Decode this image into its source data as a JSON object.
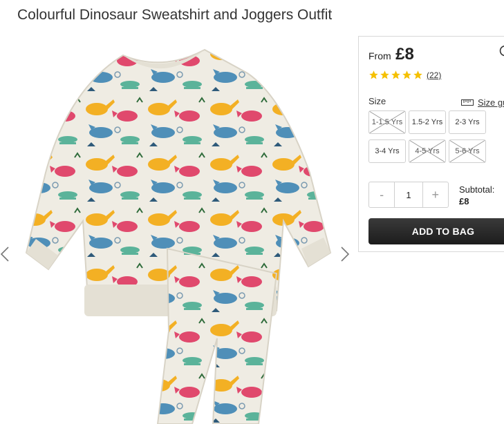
{
  "product": {
    "title": "Colourful Dinosaur Sweatshirt and Joggers Outfit",
    "price_from_label": "From",
    "price": "£8",
    "rating": 5,
    "review_count": "(22)"
  },
  "gallery": {
    "prev_icon": "chevron-left-icon",
    "next_icon": "chevron-right-icon"
  },
  "size": {
    "label": "Size",
    "guide_label": "Size gu",
    "options": [
      {
        "label": "1-1.5 Yrs",
        "available": false
      },
      {
        "label": "1.5-2 Yrs",
        "available": true
      },
      {
        "label": "2-3 Yrs",
        "available": true
      },
      {
        "label": "3-4 Yrs",
        "available": true
      },
      {
        "label": "4-5 Yrs",
        "available": false
      },
      {
        "label": "5-6 Yrs",
        "available": false
      }
    ]
  },
  "quantity": {
    "minus": "-",
    "value": "1",
    "plus": "+"
  },
  "subtotal": {
    "label": "Subtotal:",
    "value": "£8"
  },
  "cart": {
    "add_label": "ADD TO BAG"
  },
  "colors": {
    "star": "#f5c000",
    "button": "#222222",
    "border": "#d8d8d8"
  }
}
